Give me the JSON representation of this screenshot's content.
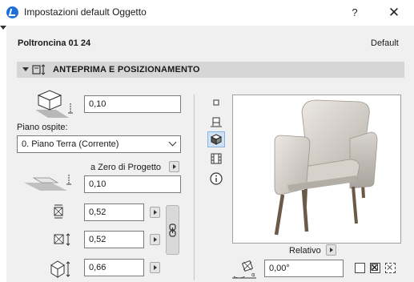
{
  "window": {
    "title": "Impostazioni default Oggetto",
    "help_label": "?",
    "close_label": "✕"
  },
  "object": {
    "name": "Poltroncina 01 24",
    "default_label": "Default"
  },
  "section": {
    "title": "ANTEPRIMA E POSIZIONAMENTO",
    "icon": "preview-position-icon"
  },
  "positioning": {
    "elevation_value": "0,10",
    "host_story_label": "Piano ospite:",
    "host_story_value": "0. Piano Terra (Corrente)",
    "reference_label": "a Zero di Progetto",
    "project_zero_value": "0,10",
    "width_value": "0,52",
    "depth_value": "0,52",
    "height_value": "0,66"
  },
  "view_modes": [
    {
      "icon": "floor-plan-icon"
    },
    {
      "icon": "section-view-icon"
    },
    {
      "icon": "3d-view-icon",
      "active": true
    },
    {
      "icon": "elevation-film-icon"
    },
    {
      "icon": "info-icon"
    }
  ],
  "preview": {
    "relative_label": "Relativo",
    "rotation_value": "0,00°",
    "image": "armchair-3d-preview"
  },
  "colors": {
    "accent": "#1e6fd9",
    "panel_bg": "#f0f0f0",
    "header_bg": "#d6d6d6",
    "active_bg": "#cfe1f5"
  }
}
